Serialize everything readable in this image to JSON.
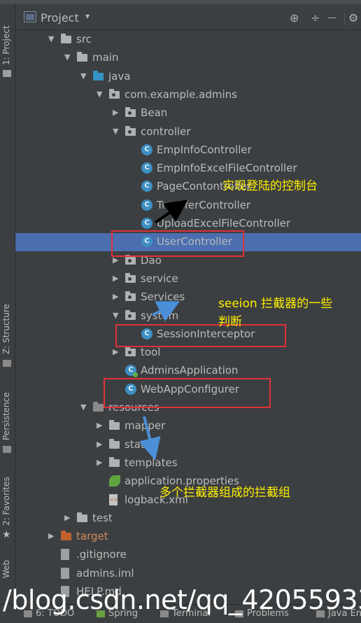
{
  "header": {
    "title": "Project",
    "caret": "▾",
    "icon_target": "⊕",
    "icon_collapse": "÷",
    "icon_settings": "⚙"
  },
  "left_tabs": {
    "project": "1: Project",
    "structure": "Z: Structure",
    "persistence": "Persistence",
    "favorites": "2: Favorites",
    "web": "Web"
  },
  "tree": [
    {
      "label": "src",
      "depth": 1,
      "arrow": "▼",
      "icon": "folder"
    },
    {
      "label": "main",
      "depth": 2,
      "arrow": "▼",
      "icon": "folder"
    },
    {
      "label": "java",
      "depth": 3,
      "arrow": "▼",
      "icon": "folder-blue"
    },
    {
      "label": "com.example.admins",
      "depth": 4,
      "arrow": "▼",
      "icon": "package"
    },
    {
      "label": "Bean",
      "depth": 5,
      "arrow": "▶",
      "icon": "package"
    },
    {
      "label": "controller",
      "depth": 5,
      "arrow": "▼",
      "icon": "package"
    },
    {
      "label": "EmpInfoController",
      "depth": 6,
      "arrow": "",
      "icon": "class"
    },
    {
      "label": "EmpInfoExcelFileController",
      "depth": 6,
      "arrow": "",
      "icon": "class"
    },
    {
      "label": "PageContontroller",
      "depth": 6,
      "arrow": "",
      "icon": "class"
    },
    {
      "label": "TransferController",
      "depth": 6,
      "arrow": "",
      "icon": "class"
    },
    {
      "label": "UploadExcelFileController",
      "depth": 6,
      "arrow": "",
      "icon": "class"
    },
    {
      "label": "UserController",
      "depth": 6,
      "arrow": "",
      "icon": "class",
      "selected": true
    },
    {
      "label": "Dao",
      "depth": 5,
      "arrow": "▶",
      "icon": "package"
    },
    {
      "label": "service",
      "depth": 5,
      "arrow": "▶",
      "icon": "package"
    },
    {
      "label": "Services",
      "depth": 5,
      "arrow": "▶",
      "icon": "package"
    },
    {
      "label": "system",
      "depth": 5,
      "arrow": "▼",
      "icon": "package"
    },
    {
      "label": "SessionInterceptor",
      "depth": 6,
      "arrow": "",
      "icon": "class"
    },
    {
      "label": "tool",
      "depth": 5,
      "arrow": "▶",
      "icon": "package"
    },
    {
      "label": "AdminsApplication",
      "depth": 5,
      "arrow": "",
      "icon": "class-app"
    },
    {
      "label": "WebAppConfigurer",
      "depth": 5,
      "arrow": "",
      "icon": "class"
    },
    {
      "label": "resources",
      "depth": 3,
      "arrow": "▼",
      "icon": "folder-res"
    },
    {
      "label": "mapper",
      "depth": 4,
      "arrow": "▶",
      "icon": "folder"
    },
    {
      "label": "static",
      "depth": 4,
      "arrow": "▶",
      "icon": "folder"
    },
    {
      "label": "templates",
      "depth": 4,
      "arrow": "▶",
      "icon": "folder"
    },
    {
      "label": "application.properties",
      "depth": 4,
      "arrow": "",
      "icon": "file-leaf"
    },
    {
      "label": "logback.xml",
      "depth": 4,
      "arrow": "",
      "icon": "file-xml"
    },
    {
      "label": "test",
      "depth": 2,
      "arrow": "▶",
      "icon": "folder"
    },
    {
      "label": "target",
      "depth": 1,
      "arrow": "▶",
      "icon": "folder-orange"
    },
    {
      "label": ".gitignore",
      "depth": 1,
      "arrow": "",
      "icon": "file"
    },
    {
      "label": "admins.iml",
      "depth": 1,
      "arrow": "",
      "icon": "file"
    },
    {
      "label": "HELP.md",
      "depth": 1,
      "arrow": "",
      "icon": "file"
    }
  ],
  "bottom_tabs": {
    "todo": "6: TODO",
    "spring": "Spring",
    "terminal": "Terminal",
    "problems": "Problems",
    "java_enterprise": "Java En"
  },
  "annotations": {
    "console": "实现登陆的控制台",
    "session_line1": "seeion 拦截器的一些",
    "session_line2": "判断",
    "interceptors": "多个拦截器组成的拦截组"
  },
  "watermark": "/blog.csdn.net/qq_42055933",
  "colors": {
    "background": "#3c3f41",
    "selection": "#4b6eaf",
    "annotation_text": "#ffef00",
    "highlight_box": "#e0303a",
    "arrow_blue": "#4a8fd8"
  }
}
